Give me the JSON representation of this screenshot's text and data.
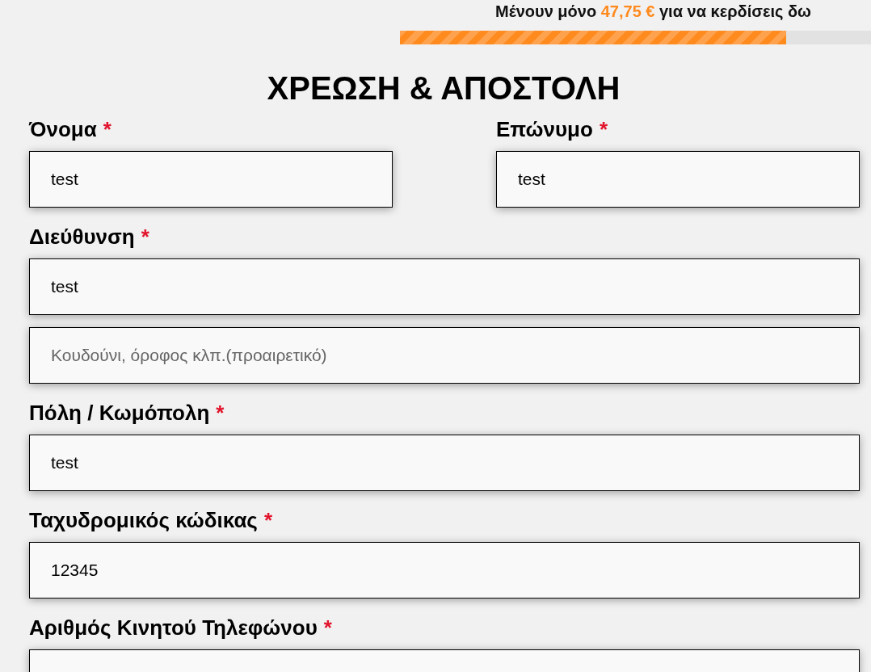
{
  "progress": {
    "message_before": "Μένουν μόνο",
    "amount": "47,75 €",
    "message_after": "για να κερδίσεις δω",
    "level": 0.82
  },
  "title": "ΧΡΕΩΣΗ & ΑΠΟΣΤΟΛΗ",
  "rows": [
    {
      "fields": [
        {
          "label": "Όνομα",
          "required_mark": "*",
          "value": "test"
        },
        {
          "label": "Επώνυμο",
          "required_mark": "*",
          "value": "test"
        }
      ]
    },
    {
      "fields": [
        {
          "label": "Διεύθυνση",
          "required_mark": "*",
          "value": "test"
        }
      ]
    },
    {
      "fields": [
        {
          "placeholder": "Κουδούνι, όροφος κλπ.(προαιρετικό)"
        }
      ]
    },
    {
      "fields": [
        {
          "label": "Πόλη / Κωμόπολη",
          "required_mark": "*",
          "value": "test"
        }
      ]
    },
    {
      "fields": [
        {
          "label": "Ταχυδρομικός κώδικας",
          "required_mark": "*",
          "value": "12345"
        }
      ]
    },
    {
      "fields": [
        {
          "label": "Αριθμός Κινητού Τηλεφώνου",
          "required_mark": "*"
        }
      ]
    }
  ]
}
